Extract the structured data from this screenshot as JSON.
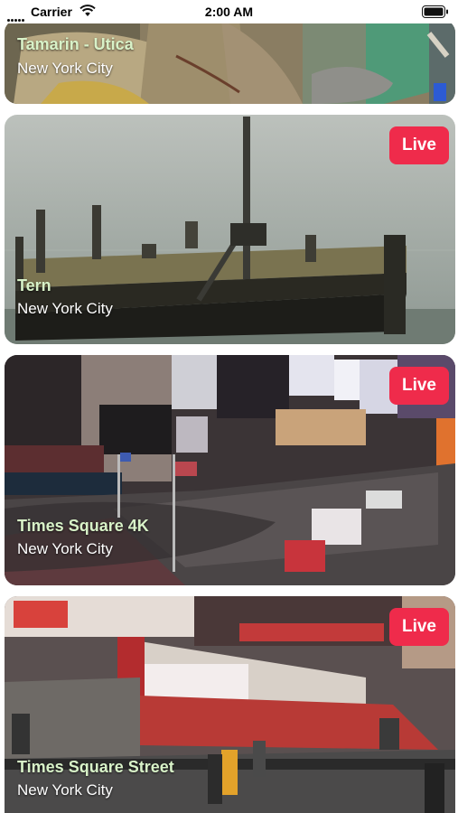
{
  "status_bar": {
    "carrier": "Carrier",
    "time": "2:00 AM"
  },
  "cameras": [
    {
      "title": "Tamarin - Utica",
      "location": "New York City"
    },
    {
      "title": "Tern",
      "location": "New York City",
      "badge": "Live"
    },
    {
      "title": "Times Square 4K",
      "location": "New York City",
      "badge": "Live"
    },
    {
      "title": "Times Square Street",
      "location": "New York City",
      "badge": "Live"
    }
  ],
  "colors": {
    "live_badge": "#ef2b4b",
    "title_text": "#d8f2c8",
    "subtitle_text": "#ffffff"
  },
  "icons": [
    "signal-dots-icon",
    "wifi-icon",
    "battery-icon"
  ]
}
